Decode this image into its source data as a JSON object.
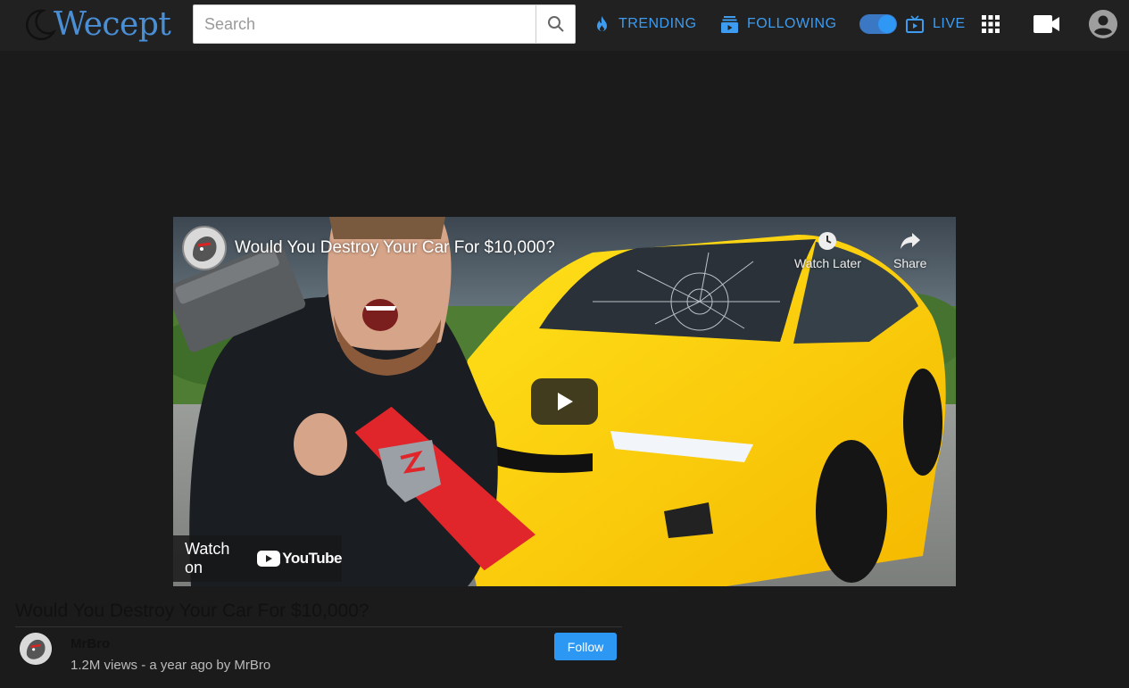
{
  "header": {
    "brand": "Wecept",
    "search": {
      "placeholder": "Search",
      "value": ""
    },
    "nav": [
      {
        "label": "TRENDING",
        "icon": "flame-icon"
      },
      {
        "label": "FOLLOWING",
        "icon": "subscriptions-icon"
      },
      {
        "label": "LIVE",
        "icon": "live-tv-icon"
      }
    ],
    "toggle_on": true,
    "accent": "#3d9cf0"
  },
  "player": {
    "title": "Would You Destroy Your Car For $10,000?",
    "watch_later": "Watch Later",
    "share": "Share",
    "watch_on": "Watch on",
    "yt_brand": "YouTube"
  },
  "video": {
    "title": "Would You Destroy Your Car For $10,000?",
    "channel": "MrBro",
    "meta": "1.2M views - a year ago by MrBro",
    "follow_label": "Follow"
  }
}
